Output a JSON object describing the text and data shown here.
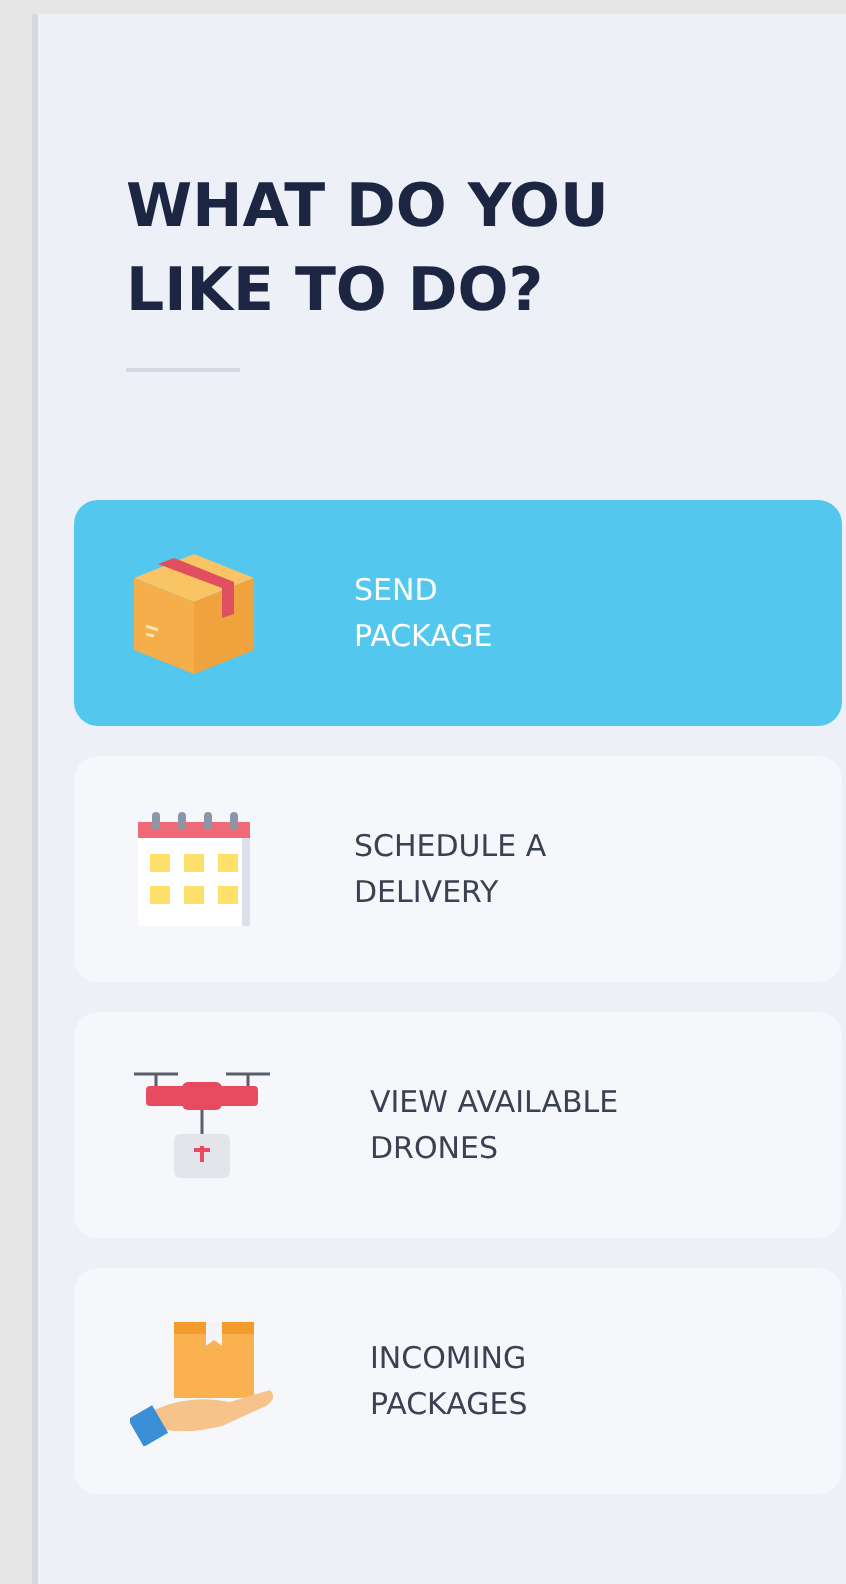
{
  "title": "WHAT DO YOU LIKE TO DO?",
  "actions": [
    {
      "label": "SEND\nPACKAGE",
      "kind": "box",
      "selected": true
    },
    {
      "label": "SCHEDULE A\nDELIVERY",
      "kind": "calendar",
      "selected": false
    },
    {
      "label": "VIEW AVAILABLE\nDRONES",
      "kind": "drone",
      "selected": false
    },
    {
      "label": "INCOMING\nPACKAGES",
      "kind": "hand-box",
      "selected": false
    }
  ]
}
